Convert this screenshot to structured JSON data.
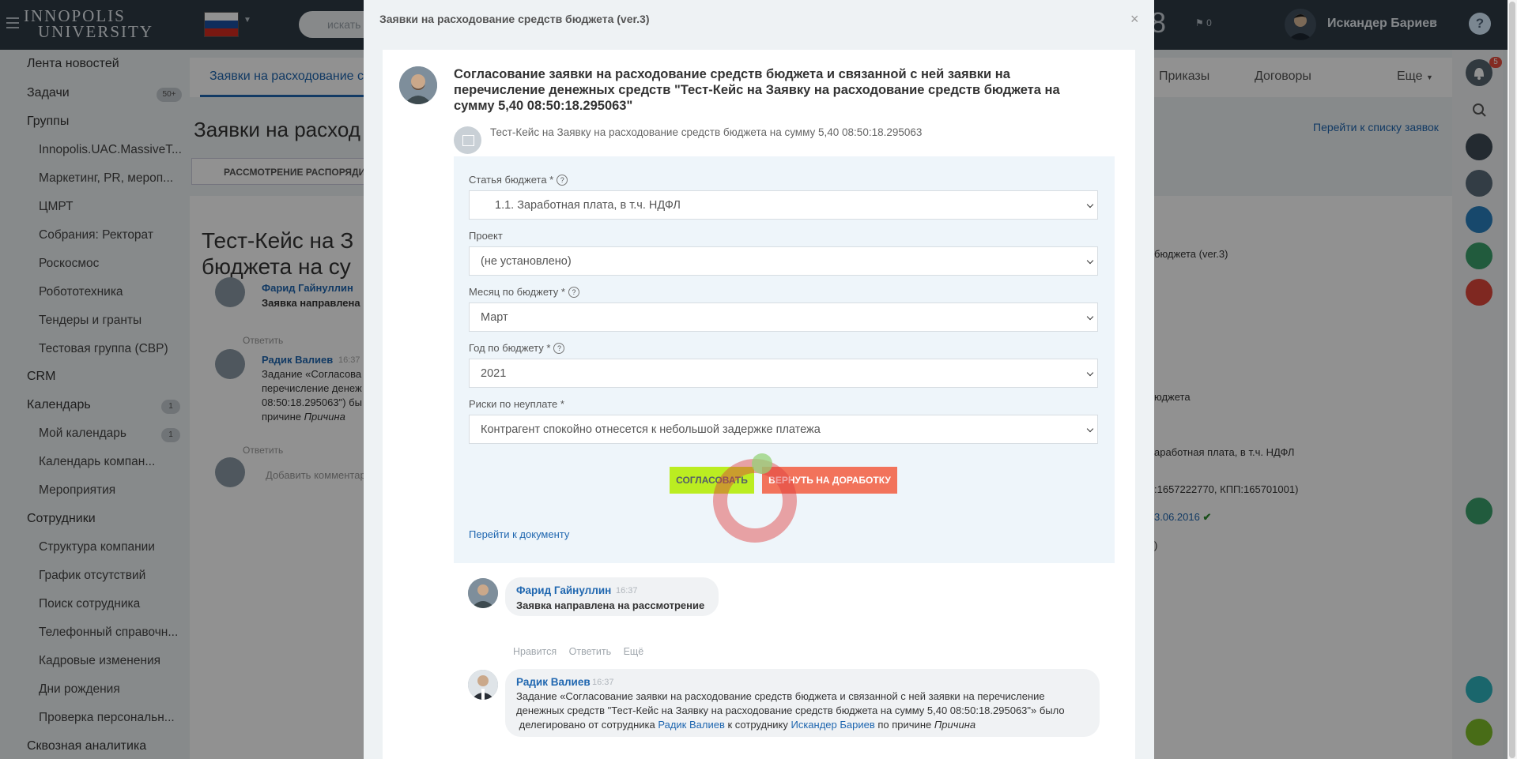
{
  "header": {
    "logo_line1": "INNOPOLIS",
    "logo_line2": "UNIVERSITY",
    "search_placeholder": "искать сот",
    "time_fragment": "8",
    "flag_count": "0",
    "user_name": "Искандер Бариев",
    "help": "?"
  },
  "sidebar": {
    "items": [
      {
        "label": "Лента новостей"
      },
      {
        "label": "Задачи",
        "counter": "50+"
      },
      {
        "label": "Группы"
      },
      {
        "label": "Innopolis.UAC.MassiveT..."
      },
      {
        "label": "Маркетинг, PR, мероп..."
      },
      {
        "label": "ЦМРТ"
      },
      {
        "label": "Собрания: Ректорат"
      },
      {
        "label": "Роскосмос"
      },
      {
        "label": "Робототехника"
      },
      {
        "label": "Тендеры и гранты"
      },
      {
        "label": "Тестовая группа (СВР)"
      },
      {
        "label": "CRM"
      },
      {
        "label": "Календарь",
        "counter": "1"
      },
      {
        "label": "Мой календарь",
        "counter": "1"
      },
      {
        "label": "Календарь компан..."
      },
      {
        "label": "Мероприятия"
      },
      {
        "label": "Сотрудники"
      },
      {
        "label": "Структура компании"
      },
      {
        "label": "График отсутствий"
      },
      {
        "label": "Поиск сотрудника"
      },
      {
        "label": "Телефонный справочн..."
      },
      {
        "label": "Кадровые изменения"
      },
      {
        "label": "Дни рождения"
      },
      {
        "label": "Проверка персональн..."
      },
      {
        "label": "Сквозная аналитика"
      }
    ]
  },
  "main": {
    "tab_active": "Заявки на расходование с",
    "tab_orders": "Приказы",
    "tab_contracts": "Договоры",
    "tab_more": "Еще",
    "page_title": "Заявки на расход",
    "goto_list": "Перейти к списку заявок",
    "filter_button": "РАССМОТРЕНИЕ РАСПОРЯДИТ",
    "big_title_line1": "Тест-Кейс на З",
    "big_title_line2": "бюджета на су",
    "bg_author1": "Фарид Гайнуллин",
    "bg_text1": "Заявка направлена",
    "bg_reply1": "Ответить",
    "bg_author2": "Радик Валиев",
    "bg_time2": "16:37",
    "bg_text2_l1": "Задание «Согласова",
    "bg_text2_l2": "перечисление денеж",
    "bg_text2_l3": "08:50:18.295063\") бы",
    "bg_text2_l4_prefix": "причине",
    "bg_text2_l4_reason": "Причина",
    "bg_reply2": "Ответить",
    "bg_comment_placeholder": "Добавить комментар",
    "bg_right1": "бюджета (ver.3)",
    "bg_right2": "юджета",
    "bg_right3": "аработная плата, в т.ч. НДФЛ",
    "bg_right4": ":1657222770, КПП:165701001)",
    "bg_right5": "3.06.2016",
    "bg_right6": ")"
  },
  "rail": {
    "notif_count": "5"
  },
  "modal": {
    "title": "Заявки на расходование средств бюджета (ver.3)",
    "close": "×",
    "task_title": "Согласование заявки на расходование средств бюджета и связанной с ней заявки на перечисление денежных средств \"Тест-Кейс на Заявку на расходование средств бюджета на сумму 5,40 08:50:18.295063\"",
    "doc_subtitle": "Тест-Кейс на Заявку на расходование средств бюджета на сумму 5,40 08:50:18.295063",
    "fields": {
      "budget_item_label": "Статья бюджета *",
      "budget_item_value": "1.1. Заработная плата, в т.ч. НДФЛ",
      "project_label": "Проект",
      "project_value": "(не установлено)",
      "month_label": "Месяц по бюджету *",
      "month_value": "Март",
      "year_label": "Год по бюджету *",
      "year_value": "2021",
      "risk_label": "Риски по неуплате *",
      "risk_value": "Контрагент спокойно отнесется к небольшой задержке платежа"
    },
    "approve_button": "СОГЛАСОВАТЬ",
    "return_button": "ВЕРНУТЬ НА ДОРАБОТКУ",
    "goto_doc": "Перейти к документу",
    "comments": [
      {
        "author": "Фарид Гайнуллин",
        "time": "16:37",
        "text": "Заявка направлена на рассмотрение",
        "actions": [
          "Нравится",
          "Ответить",
          "Ещё"
        ]
      },
      {
        "author": "Радик Валиев",
        "time": "16:37",
        "text_l1": "Задание «Согласование заявки на расходование средств бюджета и связанной с ней заявки на перечисление",
        "text_l2": "денежных средств \"Тест-Кейс на Заявку на расходование средств бюджета на сумму 5,40 08:50:18.295063\"» было",
        "text_l3_a": " делегировано от сотрудника",
        "text_l3_user1": "Радик Валиев",
        "text_l3_b": "к сотруднику",
        "text_l3_user2": "Искандер Бариев",
        "text_l3_c": "по причине",
        "text_l3_reason": "Причина"
      }
    ]
  },
  "colors": {
    "header_bg": "#2e3a46",
    "link": "#2067b0",
    "approve": "#bbed21",
    "return": "#f2735b"
  }
}
